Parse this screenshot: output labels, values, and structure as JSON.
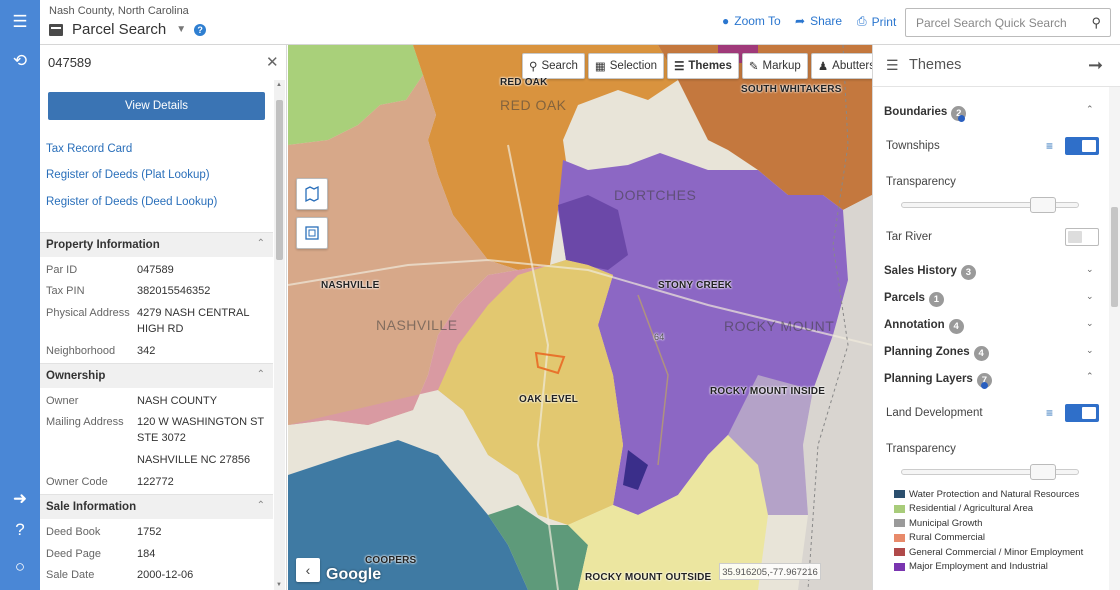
{
  "header": {
    "county": "Nash County, North Carolina",
    "title": "Parcel Search",
    "zoom_to": "Zoom To",
    "share": "Share",
    "print": "Print",
    "search_placeholder": "Parcel Search Quick Search"
  },
  "parcel": {
    "id": "047589",
    "view_details": "View Details",
    "links": [
      "Tax Record Card",
      "Register of Deeds (Plat Lookup)",
      "Register of Deeds (Deed Lookup)"
    ],
    "property_title": "Property Information",
    "property": [
      {
        "k": "Par ID",
        "v": "047589"
      },
      {
        "k": "Tax PIN",
        "v": "382015546352"
      },
      {
        "k": "Physical Address",
        "v": "4279 NASH CENTRAL HIGH RD"
      },
      {
        "k": "Neighborhood",
        "v": "342"
      }
    ],
    "ownership_title": "Ownership",
    "ownership": [
      {
        "k": "Owner",
        "v": "NASH COUNTY"
      },
      {
        "k": "Mailing Address",
        "v": "120 W WASHINGTON ST STE 3072"
      },
      {
        "k": "",
        "v": "NASHVILLE NC 27856"
      },
      {
        "k": "Owner Code",
        "v": "122772"
      }
    ],
    "sale_title": "Sale Information",
    "sale": [
      {
        "k": "Deed Book",
        "v": "1752"
      },
      {
        "k": "Deed Page",
        "v": "184"
      },
      {
        "k": "Sale Date",
        "v": "2000-12-06"
      }
    ]
  },
  "map": {
    "toolbar": [
      "Search",
      "Selection",
      "Themes",
      "Markup",
      "Abutters"
    ],
    "labels": {
      "red_oak": "RED OAK",
      "south_whitakers": "SOUTH WHITAKERS",
      "dortches": "DORTCHES",
      "nashville_bold": "NASHVILLE",
      "nashville_big": "NASHVILLE",
      "stony_creek": "STONY CREEK",
      "rocky_mount": "ROCKY MOUNT",
      "rocky_mount_inside": "ROCKY MOUNT INSIDE",
      "oak_level": "OAK LEVEL",
      "coopers": "COOPERS",
      "rocky_mount_outside": "ROCKY MOUNT OUTSIDE",
      "hwy": "64"
    },
    "google": "Google",
    "coords": "35.916205,-77.967216"
  },
  "themes": {
    "title": "Themes",
    "groups": [
      {
        "name": "Boundaries",
        "count": "2"
      },
      {
        "name": "Sales History",
        "count": "3"
      },
      {
        "name": "Parcels",
        "count": "1"
      },
      {
        "name": "Annotation",
        "count": "4"
      },
      {
        "name": "Planning Zones",
        "count": "4"
      },
      {
        "name": "Planning Layers",
        "count": "7"
      }
    ],
    "townships": "Townships",
    "transparency": "Transparency",
    "tar_river": "Tar River",
    "land_development": "Land Development",
    "legend": [
      {
        "label": "Water Protection and Natural Resources",
        "color": "#2b4f6e"
      },
      {
        "label": "Residential / Agricultural Area",
        "color": "#a8cc7a"
      },
      {
        "label": "Municipal Growth",
        "color": "#9a9a9a"
      },
      {
        "label": "Rural Commercial",
        "color": "#e88a6a"
      },
      {
        "label": "General Commercial / Minor Employment",
        "color": "#b04a4a"
      },
      {
        "label": "Major Employment and Industrial",
        "color": "#7a35b0"
      }
    ]
  }
}
